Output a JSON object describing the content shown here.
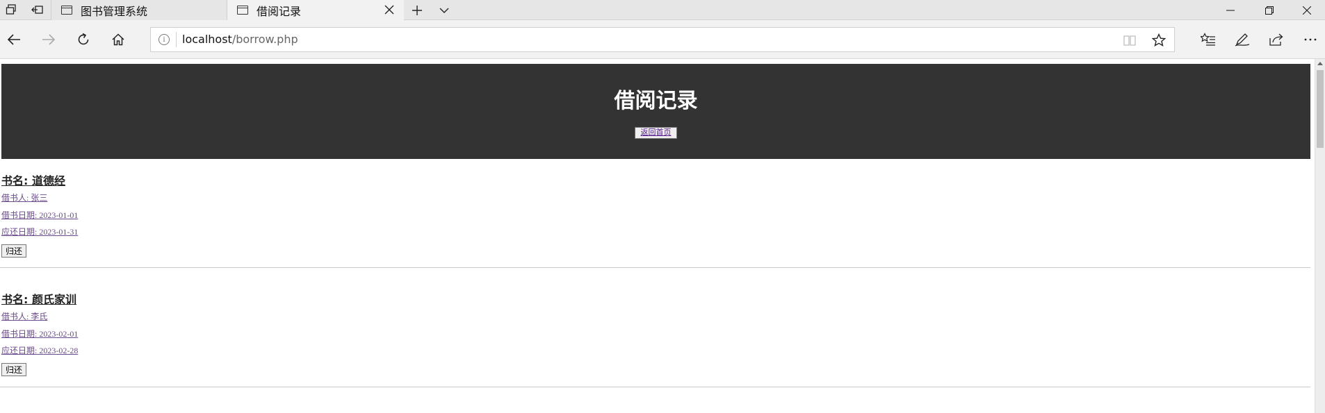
{
  "browser": {
    "tabs": [
      {
        "title": "图书管理系统",
        "active": false
      },
      {
        "title": "借阅记录",
        "active": true
      }
    ],
    "address": {
      "host": "localhost",
      "path": "/borrow.php"
    },
    "icons": [
      "tab-manager-icon",
      "set-aside-tabs-icon",
      "page-icon",
      "close-icon",
      "new-tab-icon",
      "chevron-down-icon",
      "minimize-icon",
      "restore-icon",
      "window-close-icon",
      "back-icon",
      "forward-icon",
      "refresh-icon",
      "home-icon",
      "info-icon",
      "reading-view-icon",
      "favorite-star-icon",
      "favorites-list-icon",
      "pen-icon",
      "share-icon",
      "more-icon"
    ]
  },
  "page": {
    "heading": "借阅记录",
    "home_button": "返回首页",
    "records": [
      {
        "title": "书名: 道德经",
        "borrower": "借书人: 张三",
        "borrow_date": "借书日期: 2023-01-01",
        "due_date": "应还日期: 2023-01-31",
        "return_label": "归还"
      },
      {
        "title": "书名: 颜氏家训",
        "borrower": "借书人: 李氏",
        "borrow_date": "借书日期: 2023-02-01",
        "due_date": "应还日期: 2023-02-28",
        "return_label": "归还"
      }
    ]
  },
  "colors": {
    "header_bg": "#333333",
    "link_visited": "#551a8b",
    "chrome_bg": "#f2f2f2"
  }
}
